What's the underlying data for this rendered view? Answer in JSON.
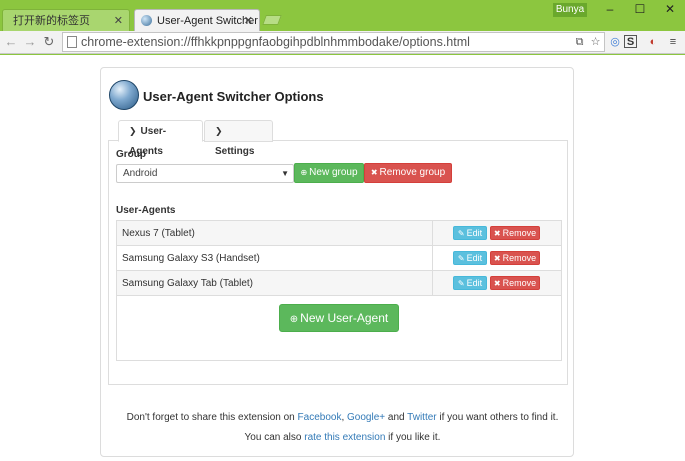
{
  "browser": {
    "tabs": [
      {
        "title": "打开新的标签页"
      },
      {
        "title": "User-Agent Switcher - O"
      }
    ],
    "user_badge": "Bunya",
    "url": "chrome-extension://ffhkkpnppgnfaobgihpdblnhmmbodake/options.html"
  },
  "page": {
    "title": "User-Agent Switcher Options",
    "tabs": [
      {
        "label": "User-Agents"
      },
      {
        "label": "Settings"
      }
    ],
    "group": {
      "label": "Group",
      "selected": "Android",
      "new_group_label": "New group",
      "remove_group_label": "Remove group"
    },
    "user_agents": {
      "label": "User-Agents",
      "edit_label": "Edit",
      "remove_label": "Remove",
      "rows": [
        {
          "name": "Nexus 7 (Tablet)"
        },
        {
          "name": "Samsung Galaxy S3 (Handset)"
        },
        {
          "name": "Samsung Galaxy Tab (Tablet)"
        }
      ],
      "new_label": "New User-Agent"
    },
    "footer": {
      "line1_pre": "Don't forget to share this extension on ",
      "facebook": "Facebook",
      "comma": ", ",
      "google": "Google+",
      "and": " and ",
      "twitter": "Twitter",
      "line1_post": " if you want others to find it.",
      "line2_pre": "You can also ",
      "rate": "rate this extension",
      "line2_post": " if you like it."
    }
  },
  "colors": {
    "frame": "#8cc63f",
    "green": "#5cb85c",
    "red": "#d9534f",
    "blue": "#5bc0de",
    "link": "#337ab7"
  }
}
